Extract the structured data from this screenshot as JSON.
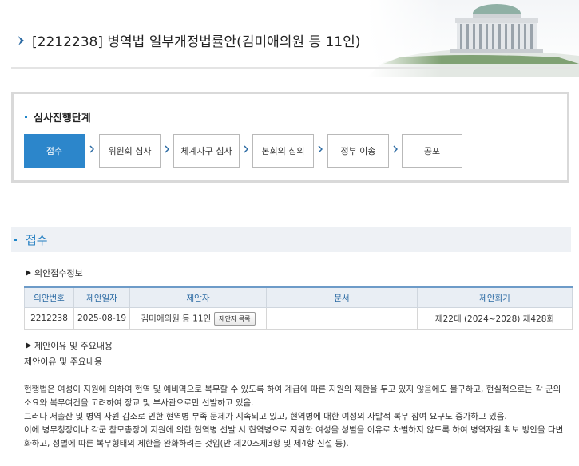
{
  "header": {
    "title": "[2212238] 병역법 일부개정법률안(김미애의원 등 11인)"
  },
  "stage": {
    "heading": "심사진행단계",
    "steps": [
      {
        "label": "접수",
        "active": true
      },
      {
        "label": "위원회 심사",
        "active": false
      },
      {
        "label": "체계자구 심사",
        "active": false
      },
      {
        "label": "본회의 심의",
        "active": false
      },
      {
        "label": "정부 이송",
        "active": false
      },
      {
        "label": "공포",
        "active": false
      }
    ]
  },
  "section": {
    "title": "접수",
    "receipt_info_label": "의안접수정보",
    "table": {
      "headers": [
        "의안번호",
        "제안일자",
        "제안자",
        "문서",
        "제안회기"
      ],
      "row": {
        "bill_no": "2212238",
        "date": "2025-08-19",
        "proposer": "김미애의원 등 11인",
        "proposer_button": "제안자 목록",
        "document": "",
        "session": "제22대 (2024~2028) 제428회"
      }
    },
    "reason_heading": "제안이유 및 주요내용",
    "reason_label": "제안이유 및 주요내용",
    "paragraphs": [
      "현행법은 여성이 지원에 의하여 현역 및 예비역으로 복무할 수 있도록 하여 계급에 따른 지원의 제한을 두고 있지 않음에도 불구하고, 현실적으로는 각 군의 소요와 복무여건을 고려하여 장교 및 부사관으로만 선발하고 있음.",
      "그러나 저출산 및 병역 자원 감소로 인한 현역병 부족 문제가 지속되고 있고, 현역병에 대한 여성의 자발적 복무 참여 요구도 증가하고 있음.",
      "이에 병무청장이나 각군 참모총장이 지원에 의한 현역병 선발 시 현역병으로 지원한 여성을 성별을 이유로 차별하지 않도록 하여 병역자원 확보 방안을 다변화하고, 성별에 따른 복무형태의 제한을 완화하려는 것임(안 제20조제3항 및 제4항 신설 등)."
    ]
  }
}
